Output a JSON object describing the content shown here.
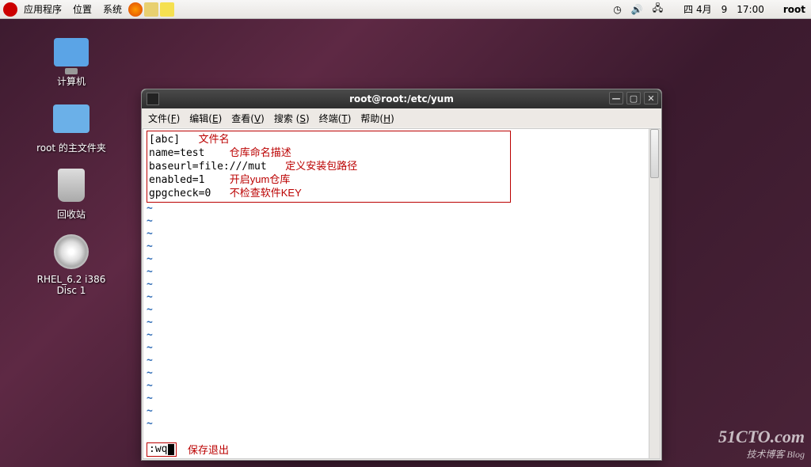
{
  "topPanel": {
    "menus": [
      "应用程序",
      "位置",
      "系统"
    ],
    "date": "四 4月",
    "day": "9",
    "time": "17:00",
    "user": "root"
  },
  "desktopIcons": {
    "computer": "计算机",
    "home": "root 的主文件夹",
    "trash": "回收站",
    "dvd": "RHEL_6.2 i386 Disc 1"
  },
  "window": {
    "title": "root@root:/etc/yum",
    "menus": {
      "file": "文件(",
      "file_k": "F",
      "edit": "编辑(",
      "edit_k": "E",
      "view": "查看(",
      "view_k": "V",
      "search_pre": "搜索 (",
      "search_k": "S",
      "terminal": "终端(",
      "terminal_k": "T",
      "help": "帮助(",
      "help_k": "H",
      "close": ")"
    }
  },
  "terminal": {
    "l1": "[abc]",
    "a1": "文件名",
    "l2": "name=test",
    "a2": "仓库命名描述",
    "l3": "baseurl=file:///mut",
    "a3": "定义安装包路径",
    "l4": "enabled=1",
    "a4": "开启yum仓库",
    "l5": "gpgcheck=0",
    "a5": "不检查软件KEY",
    "tilde": "~",
    "vimcmd": ":wq",
    "saveexit": "保存退出"
  },
  "watermark": {
    "big": "51CTO.com",
    "small": "技术博客",
    "blog": "Blog"
  }
}
